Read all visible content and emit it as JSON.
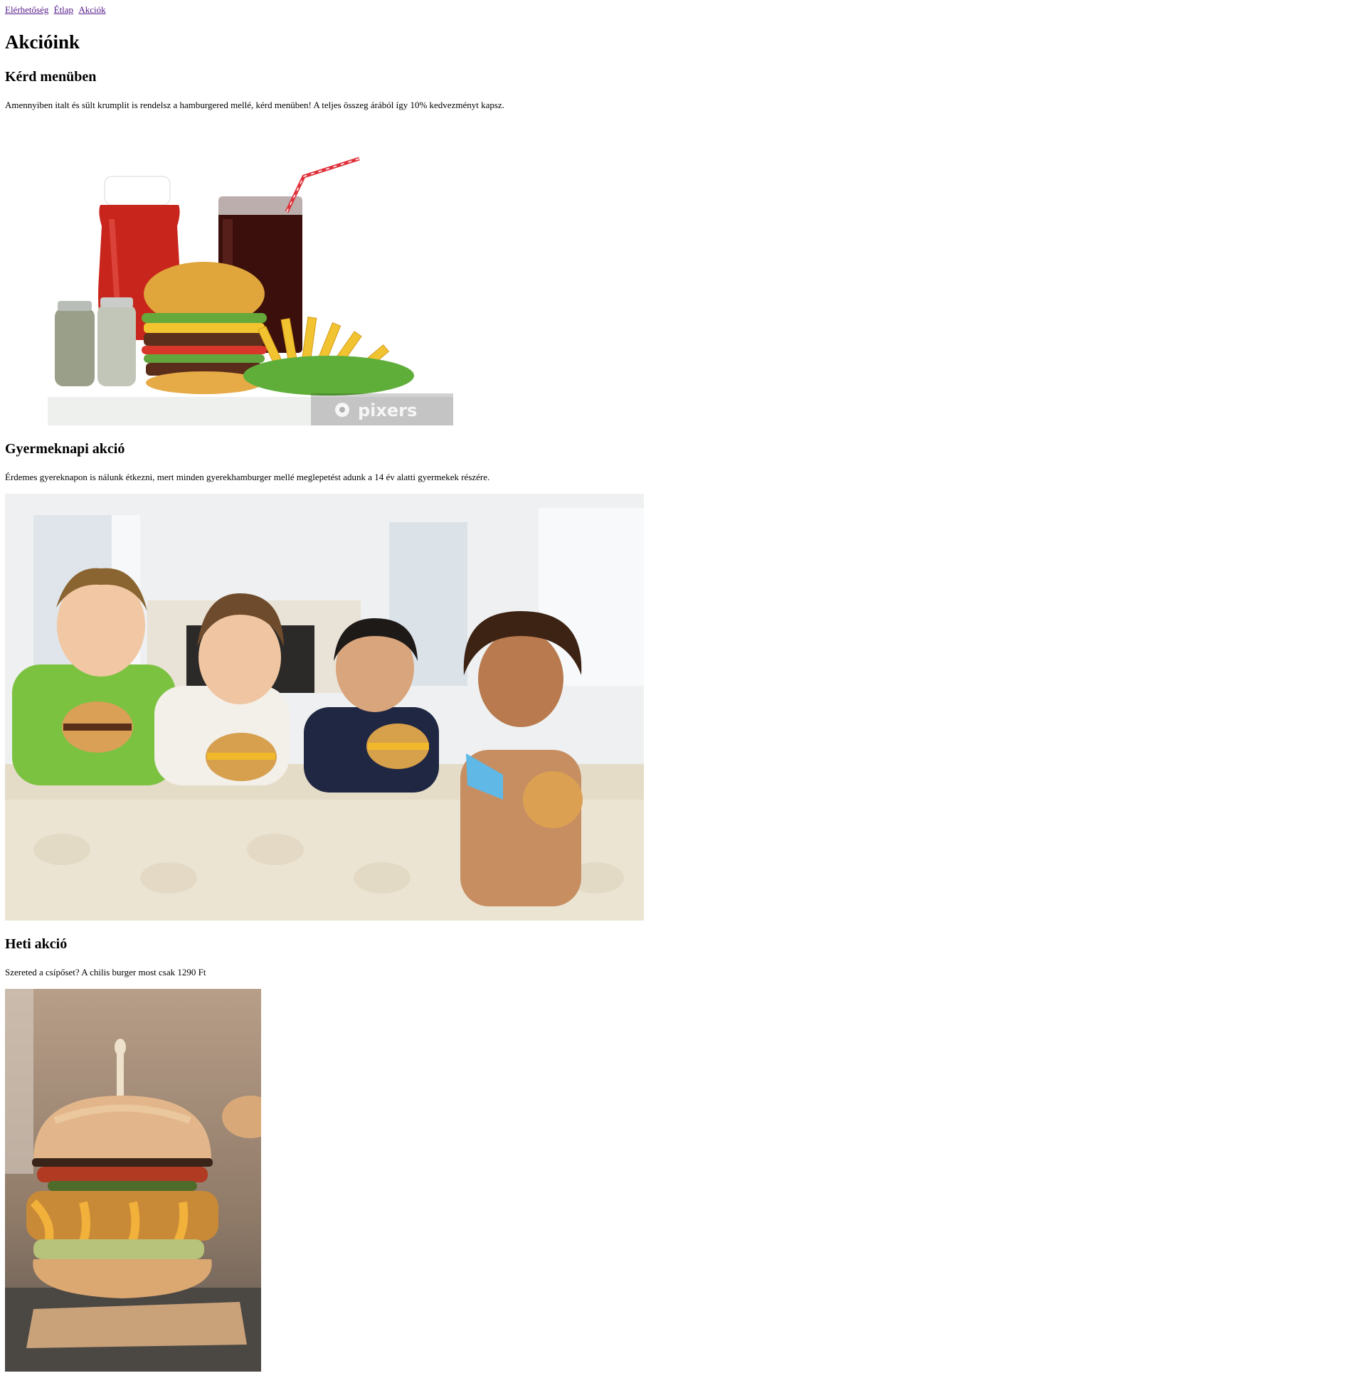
{
  "nav": {
    "links": [
      "Elérhetőség",
      "Étlap",
      "Akciók"
    ]
  },
  "page": {
    "title": "Akcióink"
  },
  "sections": [
    {
      "heading": "Kérd menüben",
      "text": "Amennyiben italt és sült krumplit is rendelsz a hamburgered mellé, kérd menüben! A teljes összeg árából így 10% kedvezményt kapsz.",
      "image": {
        "subject": "burger, fries, cola, ketchup and salt & pepper shakers",
        "watermark": "pixers"
      }
    },
    {
      "heading": "Gyermeknapi akció",
      "text": "Érdemes gyereknapon is nálunk étkezni, mert minden gyerekhamburger mellé meglepetést adunk a 14 év alatti gyermekek részére.",
      "image": {
        "subject": "four children holding hamburgers on a sofa"
      }
    },
    {
      "heading": "Heti akció",
      "text": "Szereted a csípőset? A chilis burger most csak 1290 Ft",
      "image": {
        "subject": "chili burger with melted cheese"
      }
    }
  ],
  "colors": {
    "link": "#551a8b",
    "text": "#000000",
    "background": "#ffffff"
  }
}
